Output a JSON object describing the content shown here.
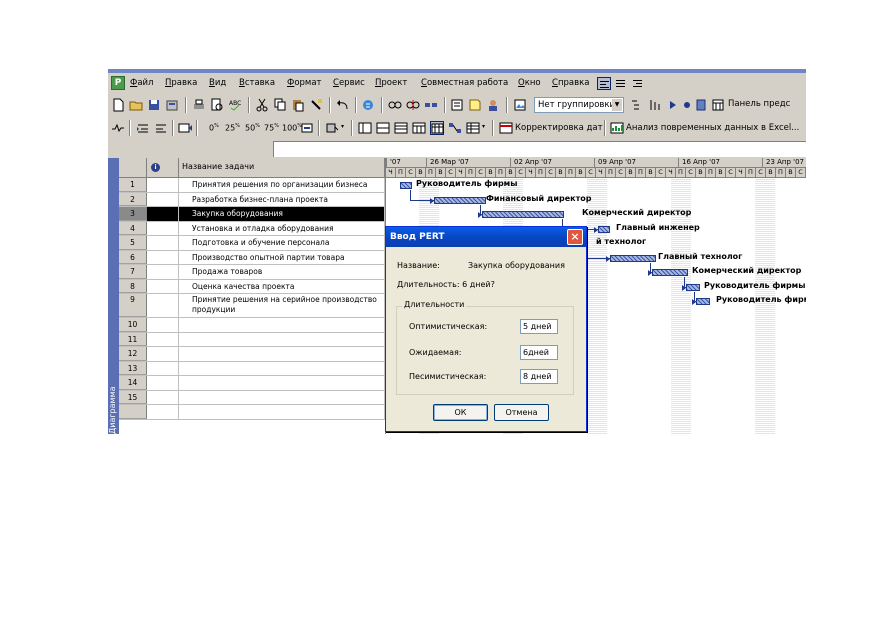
{
  "menu": {
    "items": [
      "Файл",
      "Правка",
      "Вид",
      "Вставка",
      "Формат",
      "Сервис",
      "Проект",
      "Совместная работа",
      "Окно",
      "Справка"
    ]
  },
  "toolbar": {
    "grouping_value": "Нет группировки",
    "panel_label": "Панель предс",
    "zoom_levels": [
      "0",
      "25",
      "50",
      "75",
      "100"
    ],
    "correction_label": "Корректировка дат",
    "analysis_label": "Анализ повременных данных в Excel..."
  },
  "view_bar": {
    "label": "Диаграмма Ганта"
  },
  "table": {
    "name_header": "Название задачи",
    "rows": [
      {
        "num": "1",
        "name": "Принятия решения по организации бизнеса"
      },
      {
        "num": "2",
        "name": "Разработка бизнес-плана проекта"
      },
      {
        "num": "3",
        "name": "Закупка оборудования",
        "selected": true
      },
      {
        "num": "4",
        "name": "Установка и отладка оборудования"
      },
      {
        "num": "5",
        "name": "Подготовка и обучение  персонала"
      },
      {
        "num": "6",
        "name": "Производство опытной партии товара"
      },
      {
        "num": "7",
        "name": "Продажа товаров"
      },
      {
        "num": "8",
        "name": "Оценка качества проекта"
      },
      {
        "num": "9",
        "name": "Принятие решения на серийное производство продукции"
      },
      {
        "num": "10",
        "name": ""
      },
      {
        "num": "11",
        "name": ""
      },
      {
        "num": "12",
        "name": ""
      },
      {
        "num": "13",
        "name": ""
      },
      {
        "num": "14",
        "name": ""
      },
      {
        "num": "15",
        "name": ""
      },
      {
        "num": "",
        "name": ""
      }
    ]
  },
  "gantt": {
    "weeks": [
      "'07",
      "26 Мар '07",
      "02 Апр '07",
      "09 Апр '07",
      "16 Апр '07",
      "23 Апр '07"
    ],
    "days": [
      "Ч",
      "П",
      "С",
      "В",
      "П",
      "В",
      "С",
      "Ч",
      "П",
      "С",
      "В",
      "П",
      "В",
      "С",
      "Ч",
      "П",
      "С",
      "В",
      "П",
      "В",
      "С",
      "Ч",
      "П",
      "С",
      "В",
      "П",
      "В",
      "С",
      "Ч",
      "П",
      "С",
      "В",
      "П",
      "В",
      "С",
      "Ч",
      "П",
      "С",
      "В",
      "П",
      "В",
      "С"
    ],
    "resources": [
      "Руководитель фирмы",
      "Финансовый директор",
      "Комерческий директор",
      "Главный инженер",
      "й технолог",
      "Главный технолог",
      "Комерческий директор",
      "Руководитель фирмы",
      "Руководитель фирм"
    ]
  },
  "dialog": {
    "title": "Ввод PERT",
    "name_label": "Название:",
    "name_value": "Закупка оборудования",
    "duration_text": "Длительность:  6 дней?",
    "group_title": "Длительности",
    "optimistic_label": "Оптимистическая:",
    "optimistic_value": "5 дней",
    "expected_label": "Ожидаемая:",
    "expected_value": "6дней",
    "pessimistic_label": "Песимистическая:",
    "pessimistic_value": "8 дней",
    "ok_label": "ОК",
    "cancel_label": "Отмена"
  }
}
